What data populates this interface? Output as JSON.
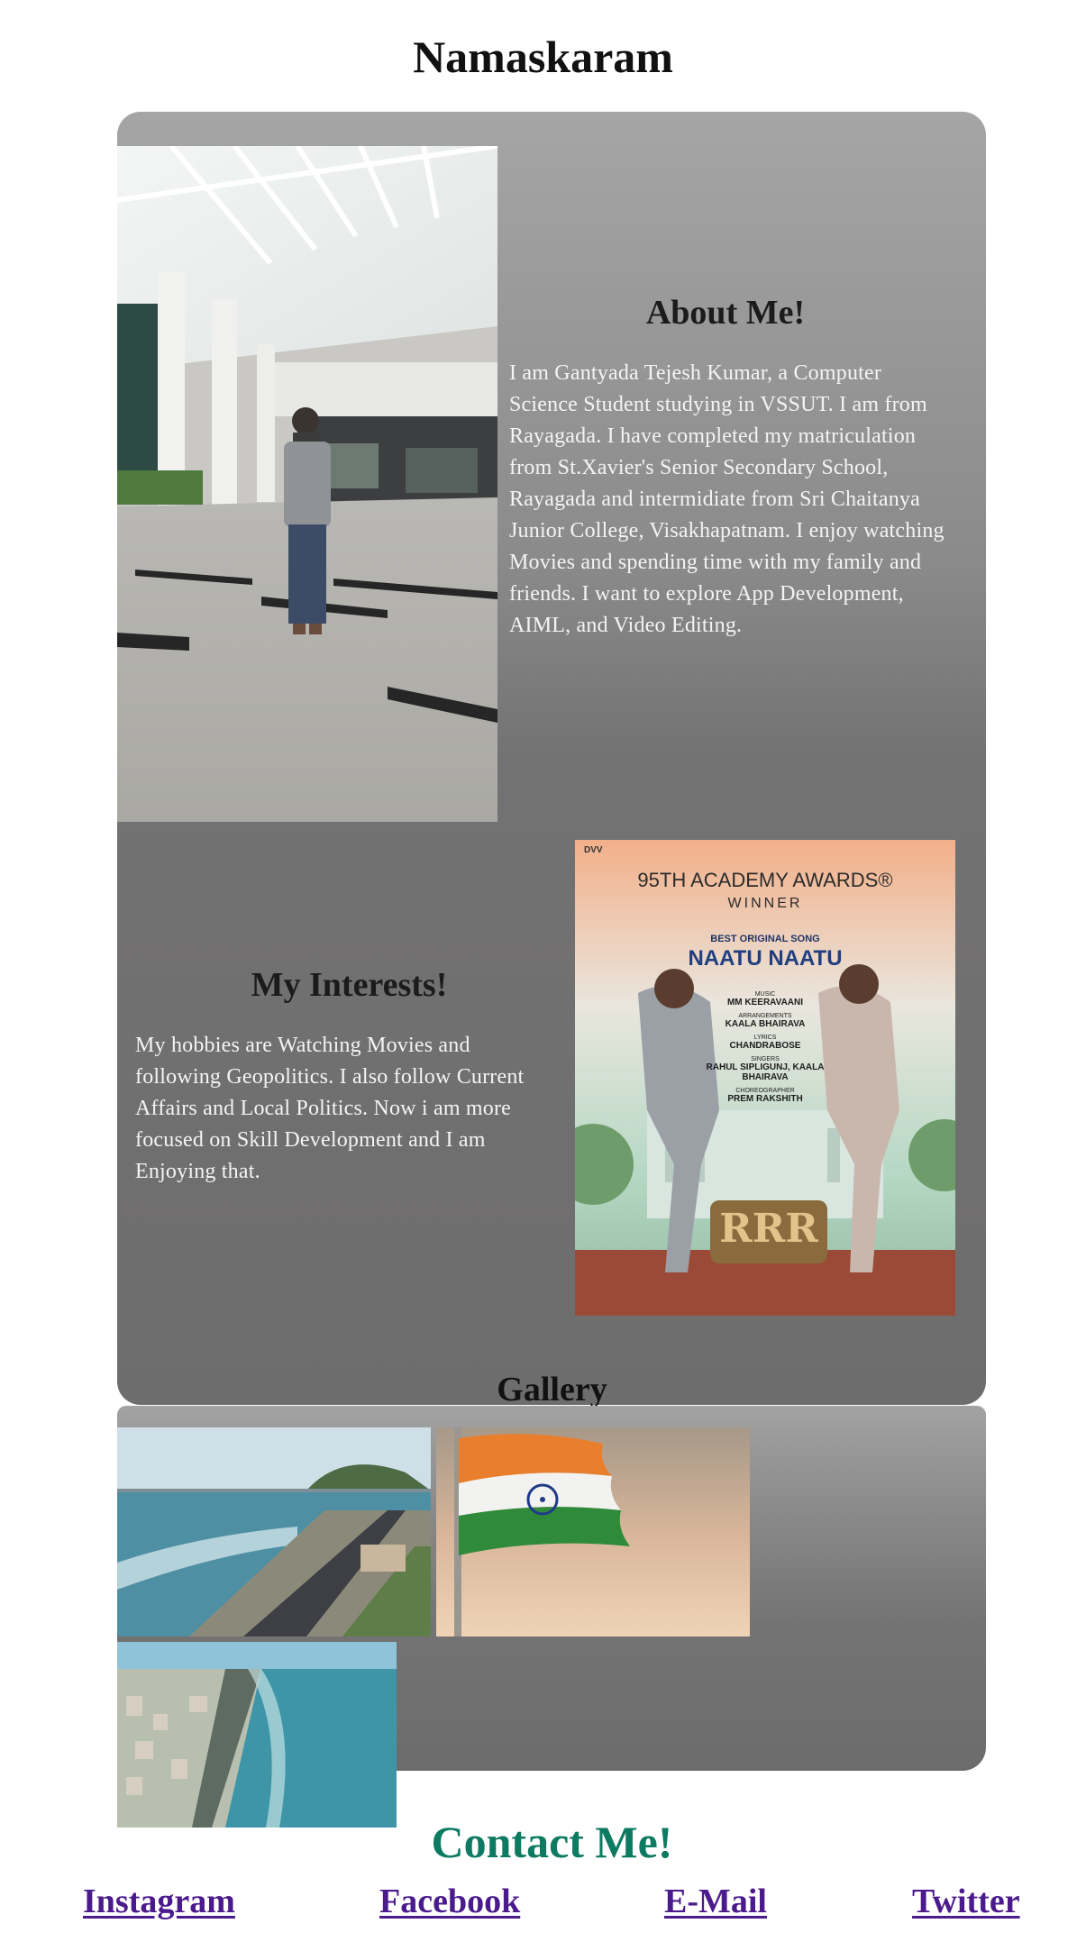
{
  "header": {
    "title": "Namaskaram"
  },
  "about": {
    "heading": "About Me!",
    "text": "I am Gantyada Tejesh Kumar, a Computer Science Student studying in VSSUT. I am from Rayagada. I have completed my matriculation from St.Xavier's Senior Secondary School, Rayagada and intermidiate from Sri Chaitanya Junior College, Visakhapatnam. I enjoy watching Movies and spending time with my family and friends. I want to explore App Development, AIML, and Video Editing."
  },
  "interests": {
    "heading": "My Interests!",
    "text": "My hobbies are Watching Movies and following Geopolitics. I also follow Current Affairs and Local Politics. Now i am more focused on Skill Development and I am Enjoying that.",
    "poster": {
      "brand": "DVV",
      "line1": "95TH ACADEMY AWARDS®",
      "line2": "WINNER",
      "category": "BEST ORIGINAL SONG",
      "song": "NAATU NAATU",
      "credits": [
        {
          "role": "MUSIC",
          "name": "MM KEERAVAANI"
        },
        {
          "role": "ARRANGEMENTS",
          "name": "KAALA BHAIRAVA"
        },
        {
          "role": "LYRICS",
          "name": "CHANDRABOSE"
        },
        {
          "role": "SINGERS",
          "name": "RAHUL SIPLIGUNJ, KAALA BHAIRAVA"
        },
        {
          "role": "CHOREOGRAPHER",
          "name": "PREM RAKSHITH"
        }
      ],
      "logo": "RRR"
    }
  },
  "gallery": {
    "heading": "Gallery"
  },
  "contact": {
    "heading": "Contact Me!",
    "links": [
      "Instagram",
      "Facebook",
      "E-Mail",
      "Twitter"
    ]
  },
  "colors": {
    "contact_heading": "#0c7b62",
    "link": "#4b1a8c"
  }
}
